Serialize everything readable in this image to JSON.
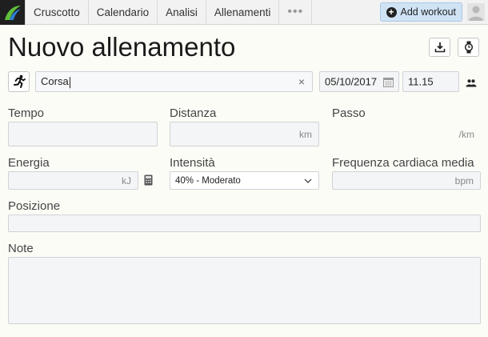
{
  "nav": {
    "items": [
      "Cruscotto",
      "Calendario",
      "Analisi",
      "Allenamenti"
    ],
    "more": "•••",
    "add_workout": "Add workout"
  },
  "page": {
    "title": "Nuovo allenamento"
  },
  "activity": {
    "sport_icon": "running-icon",
    "name_value": "Corsa",
    "date_value": "05/10/2017",
    "time_value": "11.15"
  },
  "fields": {
    "tempo_label": "Tempo",
    "distanza_label": "Distanza",
    "distanza_unit": "km",
    "passo_label": "Passo",
    "passo_unit": "/km",
    "energia_label": "Energia",
    "energia_unit": "kJ",
    "intensita_label": "Intensità",
    "intensita_value": "40% - Moderato",
    "fc_label": "Frequenza cardiaca media",
    "fc_unit": "bpm",
    "posizione_label": "Posizione",
    "note_label": "Note"
  },
  "colors": {
    "accent": "#cfe3f5",
    "field_bg": "#f4f5f6"
  }
}
